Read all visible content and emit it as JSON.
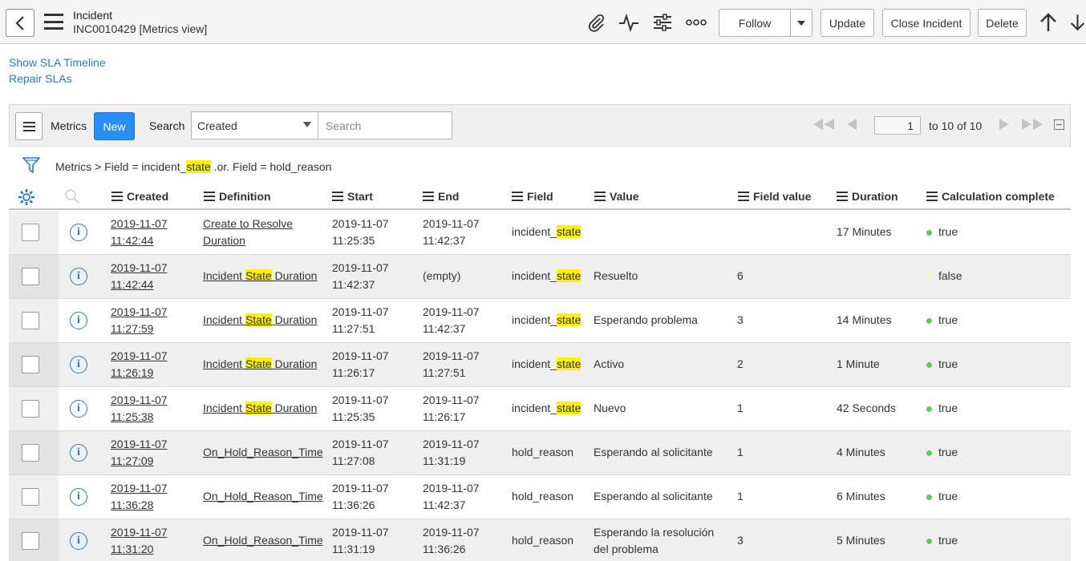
{
  "header": {
    "title": "Incident",
    "subtitle": "INC0010429 [Metrics view]",
    "buttons": {
      "follow": "Follow",
      "update": "Update",
      "close": "Close Incident",
      "delete": "Delete"
    },
    "icons": [
      "back-icon",
      "menu-icon",
      "attachment-icon",
      "activity-icon",
      "personalize-icon",
      "more-options-icon",
      "dropdown-caret-icon",
      "arrow-up-icon",
      "arrow-down-icon"
    ]
  },
  "links": {
    "sla_timeline": "Show SLA Timeline",
    "repair_slas": "Repair SLAs"
  },
  "list": {
    "title": "Metrics",
    "new_label": "New",
    "search_label": "Search",
    "search_field": "Created",
    "search_placeholder": "Search",
    "page": "1",
    "range": "to 10 of 10"
  },
  "breadcrumb": {
    "root": "Metrics",
    "sep": ">",
    "f1": "Field = incident_",
    "f1_hl": "state",
    "f2": " .or. Field = hold_reason"
  },
  "columns": {
    "created": "Created",
    "definition": "Definition",
    "start": "Start",
    "end": "End",
    "field": "Field",
    "value": "Value",
    "field_value": "Field value",
    "duration": "Duration",
    "calc": "Calculation complete"
  },
  "rows": [
    {
      "created1": "2019-11-07",
      "created2": "11:42:44",
      "def_a": "Create to Resolve",
      "def_b": "Duration",
      "start1": "2019-11-07",
      "start2": "11:25:35",
      "end1": "2019-11-07",
      "end2": "11:42:37",
      "field": "incident_",
      "field_hl": "state",
      "value": "",
      "value2": "",
      "fv": "",
      "duration": "17 Minutes",
      "calc": "true"
    },
    {
      "created1": "2019-11-07",
      "created2": "11:42:44",
      "def_a": "Incident ",
      "def_hl": "State",
      "def_b": " Duration",
      "start1": "2019-11-07",
      "start2": "11:42:37",
      "end1": "(empty)",
      "end2": "",
      "field": "incident_",
      "field_hl": "state",
      "value": "Resuelto",
      "value2": "",
      "fv": "6",
      "duration": "",
      "calc": "false"
    },
    {
      "created1": "2019-11-07",
      "created2": "11:27:59",
      "def_a": "Incident ",
      "def_hl": "State",
      "def_b": " Duration",
      "start1": "2019-11-07",
      "start2": "11:27:51",
      "end1": "2019-11-07",
      "end2": "11:42:37",
      "field": "incident_",
      "field_hl": "state",
      "value": "Esperando problema",
      "value2": "",
      "fv": "3",
      "duration": "14 Minutes",
      "calc": "true"
    },
    {
      "created1": "2019-11-07",
      "created2": "11:26:19",
      "def_a": "Incident ",
      "def_hl": "State",
      "def_b": " Duration",
      "start1": "2019-11-07",
      "start2": "11:26:17",
      "end1": "2019-11-07",
      "end2": "11:27:51",
      "field": "incident_",
      "field_hl": "state",
      "value": "Activo",
      "value2": "",
      "fv": "2",
      "duration": "1 Minute",
      "calc": "true"
    },
    {
      "created1": "2019-11-07",
      "created2": "11:25:38",
      "def_a": "Incident ",
      "def_hl": "State",
      "def_b": " Duration",
      "start1": "2019-11-07",
      "start2": "11:25:35",
      "end1": "2019-11-07",
      "end2": "11:26:17",
      "field": "incident_",
      "field_hl": "state",
      "value": "Nuevo",
      "value2": "",
      "fv": "1",
      "duration": "42 Seconds",
      "calc": "true"
    },
    {
      "created1": "2019-11-07",
      "created2": "11:27:09",
      "def_a": "On_Hold_Reason_Time",
      "def_b": "",
      "start1": "2019-11-07",
      "start2": "11:27:08",
      "end1": "2019-11-07",
      "end2": "11:31:19",
      "field": "hold_reason",
      "field_hl": "",
      "value": "Esperando al solicitante",
      "value2": "",
      "fv": "1",
      "duration": "4 Minutes",
      "calc": "true"
    },
    {
      "created1": "2019-11-07",
      "created2": "11:36:28",
      "def_a": "On_Hold_Reason_Time",
      "def_b": "",
      "start1": "2019-11-07",
      "start2": "11:36:26",
      "end1": "2019-11-07",
      "end2": "11:42:37",
      "field": "hold_reason",
      "field_hl": "",
      "value": "Esperando al solicitante",
      "value2": "",
      "fv": "1",
      "duration": "6 Minutes",
      "calc": "true"
    },
    {
      "created1": "2019-11-07",
      "created2": "11:31:20",
      "def_a": "On_Hold_Reason_Time",
      "def_b": "",
      "start1": "2019-11-07",
      "start2": "11:31:19",
      "end1": "2019-11-07",
      "end2": "11:36:26",
      "field": "hold_reason",
      "field_hl": "",
      "value": "Esperando la resolución",
      "value2": "del problema",
      "fv": "3",
      "duration": "5 Minutes",
      "calc": "true"
    }
  ],
  "colors": {
    "link": "#2b7bbd",
    "primary_button": "#278efc",
    "highlight": "#fff200",
    "dot_true": "#5ec95e",
    "dot_false": "#f6f6c0"
  }
}
